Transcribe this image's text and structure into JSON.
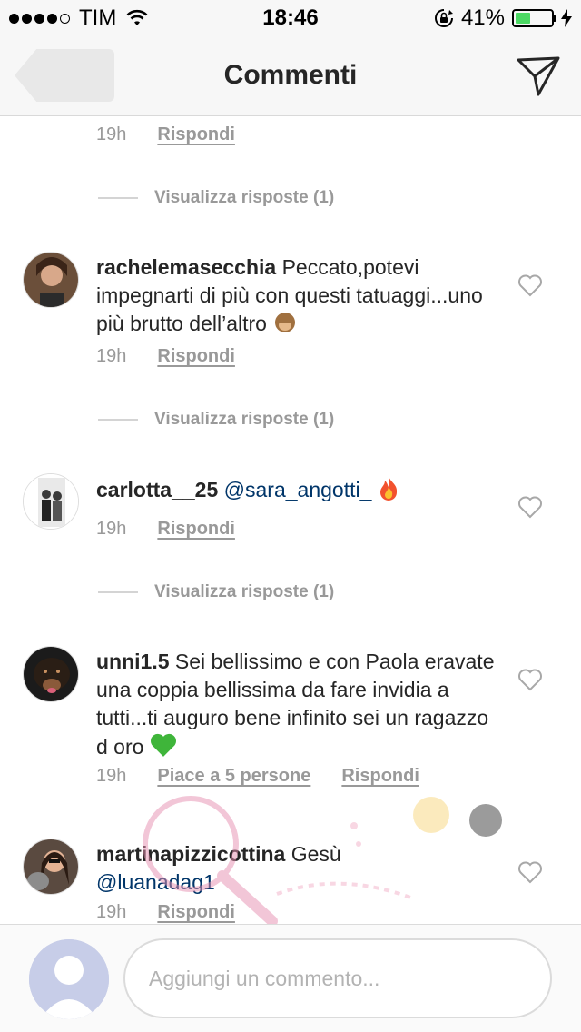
{
  "status_bar": {
    "carrier": "TIM",
    "time": "18:46",
    "battery_percent": "41%",
    "battery_level": 0.41,
    "colors": {
      "battery_fill": "#4cd964"
    }
  },
  "nav": {
    "title": "Commenti"
  },
  "first_meta": {
    "time": "19h",
    "reply": "Rispondi"
  },
  "replies_label_1": "Visualizza risposte (1)",
  "comments": [
    {
      "username": "rachelemasecchia",
      "text": "Peccato,potevi impegnarti di più con questi tatuaggi...uno più brutto dell’altro",
      "emoji": "see-no-evil-monkey",
      "time": "19h",
      "reply": "Rispondi",
      "replies_label": "Visualizza risposte (1)"
    },
    {
      "username": "carlotta__25",
      "mention": "@sara_angotti_",
      "emoji": "fire",
      "time": "19h",
      "reply": "Rispondi",
      "replies_label": "Visualizza risposte (1)"
    },
    {
      "username": "unni1.5",
      "text": "Sei bellissimo e con Paola eravate una coppia bellissima da fare invidia a tutti...ti auguro bene infinito sei un ragazzo d oro",
      "emoji": "green-heart",
      "time": "19h",
      "likes": "Piace a 5 persone",
      "reply": "Rispondi"
    },
    {
      "username": "martinapizzicottina",
      "text": "Gesù",
      "mention": "@luanadag1",
      "time": "19h",
      "reply": "Rispondi"
    }
  ],
  "footer": {
    "placeholder": "Aggiungi un commento..."
  },
  "colors": {
    "mention": "#003569",
    "muted": "#999999",
    "text": "#262626"
  }
}
